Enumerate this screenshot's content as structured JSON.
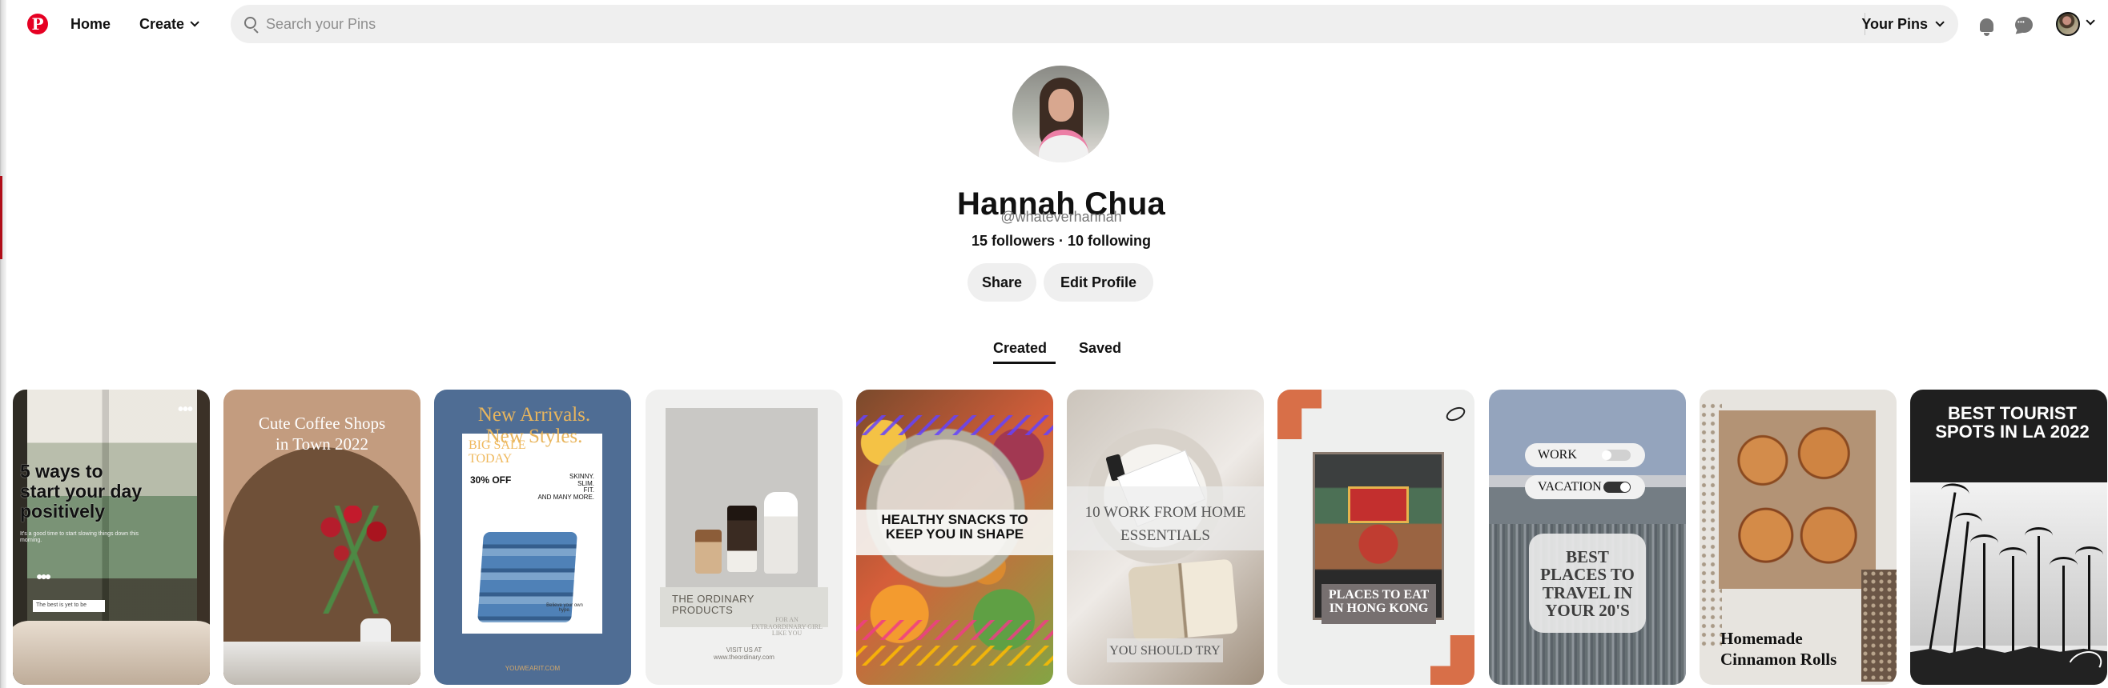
{
  "app": {
    "name": "Pinterest",
    "logo_letter": "P",
    "brand_color": "#e60023"
  },
  "header": {
    "nav": {
      "home": "Home",
      "create": "Create"
    },
    "search": {
      "placeholder": "Search your Pins",
      "value": ""
    },
    "your_pins": "Your Pins",
    "icons": [
      "notifications-icon",
      "messages-icon",
      "profile-avatar",
      "chevron-down-icon"
    ]
  },
  "profile": {
    "name": "Hannah Chua",
    "handle": "@whateverhannah",
    "stats": "15 followers · 10 following",
    "buttons": {
      "share": "Share",
      "edit": "Edit Profile"
    }
  },
  "tabs": {
    "created": "Created",
    "saved": "Saved",
    "selected": "Created"
  },
  "pins": [
    {
      "title": "5 ways to\nstart your day\npositively",
      "small_text": "It's a good time to start slowing things down this morning.",
      "note": "The best is yet to be",
      "menu": "•••"
    },
    {
      "title": "Cute Coffee Shops\nin Town 2022"
    },
    {
      "title": "New Arrivals.\nNew Styles.",
      "sale": "BIG SALE\nTODAY",
      "discount": "30% OFF",
      "copy": "SKINNY.\nSLIM.\nFIT.\nAND MANY MORE.",
      "believe": "Believe your own hype.",
      "url": "YOUWEARIT.COM"
    },
    {
      "title": "THE ORDINARY\nPRODUCTS",
      "small_text": "FOR AN\nEXTRAORDINARY GIRL\nLIKE YOU",
      "visit": "VISIT US AT\nwww.theordinary.com"
    },
    {
      "title": "HEALTHY SNACKS TO\nKEEP YOU IN SHAPE"
    },
    {
      "title": "10 WORK FROM HOME\nESSENTIALS",
      "bottom": "YOU SHOULD TRY"
    },
    {
      "title": "PLACES TO EAT\nIN HONG KONG"
    },
    {
      "work": "WORK",
      "vacation": "VACATION",
      "title": "BEST\nPLACES TO\nTRAVEL IN\nYOUR 20'S"
    },
    {
      "title": "Homemade\nCinnamon Rolls"
    },
    {
      "title": "BEST TOURIST\nSPOTS IN LA 2022"
    }
  ]
}
